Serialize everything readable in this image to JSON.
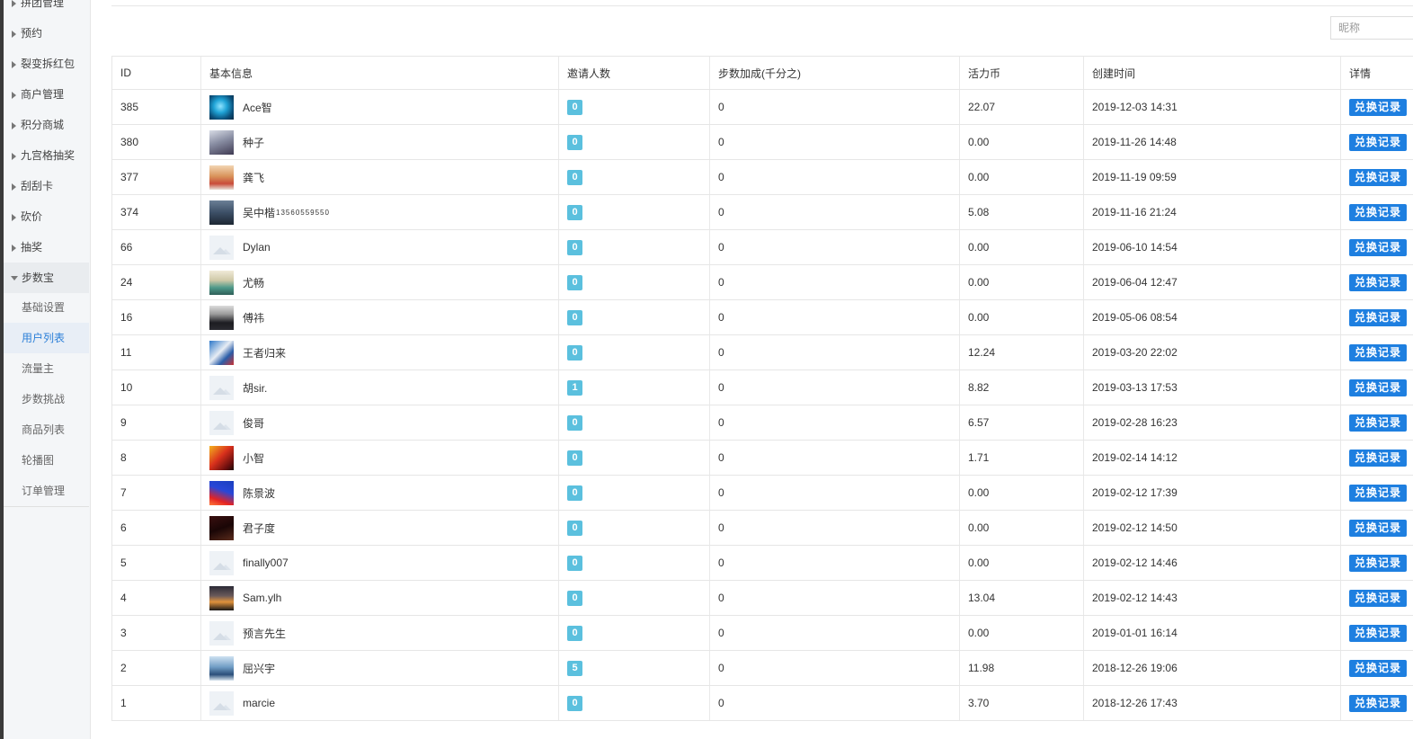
{
  "sidebar": {
    "items": [
      {
        "label": "拼团管理"
      },
      {
        "label": "预约"
      },
      {
        "label": "裂变拆红包"
      },
      {
        "label": "商户管理"
      },
      {
        "label": "积分商城"
      },
      {
        "label": "九宫格抽奖"
      },
      {
        "label": "刮刮卡"
      },
      {
        "label": "砍价"
      },
      {
        "label": "抽奖"
      },
      {
        "label": "步数宝",
        "expanded": true
      }
    ],
    "subitems": [
      {
        "label": "基础设置"
      },
      {
        "label": "用户列表",
        "active": true
      },
      {
        "label": "流量主"
      },
      {
        "label": "步数挑战"
      },
      {
        "label": "商品列表"
      },
      {
        "label": "轮播图"
      },
      {
        "label": "订单管理"
      }
    ]
  },
  "search": {
    "placeholder": "昵称"
  },
  "table": {
    "headers": [
      "ID",
      "基本信息",
      "邀请人数",
      "步数加成(千分之)",
      "活力币",
      "创建时间",
      "详情"
    ],
    "action_label": "兑换记录",
    "rows": [
      {
        "id": "385",
        "name": "Ace智",
        "phone": "",
        "avatar": "blue-orb",
        "invites": "0",
        "bonus": "0",
        "coins": "22.07",
        "created": "2019-12-03 14:31"
      },
      {
        "id": "380",
        "name": "种子",
        "phone": "",
        "avatar": "photo-room",
        "invites": "0",
        "bonus": "0",
        "coins": "0.00",
        "created": "2019-11-26 14:48"
      },
      {
        "id": "377",
        "name": "龚飞",
        "phone": "",
        "avatar": "photo-child",
        "invites": "0",
        "bonus": "0",
        "coins": "0.00",
        "created": "2019-11-19 09:59"
      },
      {
        "id": "374",
        "name": "吴中楷",
        "phone": "13560559550",
        "avatar": "photo-street",
        "invites": "0",
        "bonus": "0",
        "coins": "5.08",
        "created": "2019-11-16 21:24"
      },
      {
        "id": "66",
        "name": "Dylan",
        "phone": "",
        "avatar": "placeholder",
        "invites": "0",
        "bonus": "0",
        "coins": "0.00",
        "created": "2019-06-10 14:54"
      },
      {
        "id": "24",
        "name": "尤畅",
        "phone": "",
        "avatar": "photo-person",
        "invites": "0",
        "bonus": "0",
        "coins": "0.00",
        "created": "2019-06-04 12:47"
      },
      {
        "id": "16",
        "name": "傅祎",
        "phone": "",
        "avatar": "photo-suit",
        "invites": "0",
        "bonus": "0",
        "coins": "0.00",
        "created": "2019-05-06 08:54"
      },
      {
        "id": "11",
        "name": "王者归来",
        "phone": "",
        "avatar": "photo-game",
        "invites": "0",
        "bonus": "0",
        "coins": "12.24",
        "created": "2019-03-20 22:02"
      },
      {
        "id": "10",
        "name": "胡sir.",
        "phone": "",
        "avatar": "placeholder",
        "invites": "1",
        "bonus": "0",
        "coins": "8.82",
        "created": "2019-03-13 17:53"
      },
      {
        "id": "9",
        "name": "俊哥",
        "phone": "",
        "avatar": "placeholder",
        "invites": "0",
        "bonus": "0",
        "coins": "6.57",
        "created": "2019-02-28 16:23"
      },
      {
        "id": "8",
        "name": "小智",
        "phone": "",
        "avatar": "photo-fire",
        "invites": "0",
        "bonus": "0",
        "coins": "1.71",
        "created": "2019-02-14 14:12"
      },
      {
        "id": "7",
        "name": "陈景波",
        "phone": "",
        "avatar": "photo-redblue",
        "invites": "0",
        "bonus": "0",
        "coins": "0.00",
        "created": "2019-02-12 17:39"
      },
      {
        "id": "6",
        "name": "君子度",
        "phone": "",
        "avatar": "photo-dark",
        "invites": "0",
        "bonus": "0",
        "coins": "0.00",
        "created": "2019-02-12 14:50"
      },
      {
        "id": "5",
        "name": "finally007",
        "phone": "",
        "avatar": "placeholder",
        "invites": "0",
        "bonus": "0",
        "coins": "0.00",
        "created": "2019-02-12 14:46"
      },
      {
        "id": "4",
        "name": "Sam.ylh",
        "phone": "",
        "avatar": "photo-sunset",
        "invites": "0",
        "bonus": "0",
        "coins": "13.04",
        "created": "2019-02-12 14:43"
      },
      {
        "id": "3",
        "name": "预言先生",
        "phone": "",
        "avatar": "placeholder",
        "invites": "0",
        "bonus": "0",
        "coins": "0.00",
        "created": "2019-01-01 16:14"
      },
      {
        "id": "2",
        "name": "屈兴宇",
        "phone": "",
        "avatar": "photo-sky",
        "invites": "5",
        "bonus": "0",
        "coins": "11.98",
        "created": "2018-12-26 19:06"
      },
      {
        "id": "1",
        "name": "marcie",
        "phone": "",
        "avatar": "placeholder",
        "invites": "0",
        "bonus": "0",
        "coins": "3.70",
        "created": "2018-12-26 17:43"
      }
    ]
  },
  "colors": {
    "accent": "#1e7fe0",
    "badge": "#5bc0de",
    "active_menu_text": "#2b7fd8"
  }
}
